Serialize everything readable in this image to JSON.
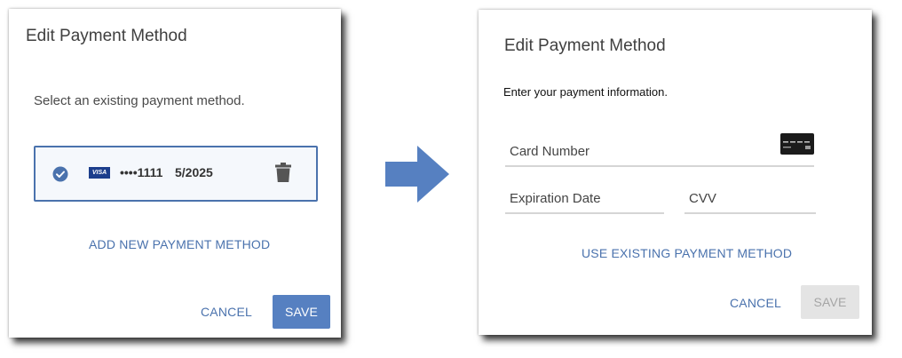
{
  "left_dialog": {
    "title": "Edit Payment Method",
    "prompt": "Select an existing payment method.",
    "saved_card": {
      "brand": "VISA",
      "masked_number": "••••1111",
      "expiration": "5/2025",
      "selected": true
    },
    "add_new_label": "ADD NEW PAYMENT METHOD",
    "cancel_label": "CANCEL",
    "save_label": "SAVE"
  },
  "right_dialog": {
    "title": "Edit Payment Method",
    "prompt": "Enter your payment information.",
    "card_number_label": "Card Number",
    "expiration_label": "Expiration Date",
    "cvv_label": "CVV",
    "use_existing_label": "USE EXISTING PAYMENT METHOD",
    "cancel_label": "CANCEL",
    "save_label": "SAVE",
    "save_enabled": false
  },
  "icons": {
    "check": "check-circle-icon",
    "card_brand": "visa-logo-icon",
    "delete": "trash-icon",
    "credit_card": "credit-card-icon",
    "transition": "arrow-right-icon"
  },
  "colors": {
    "accent": "#4a72ad",
    "primary_button": "#5680c1",
    "disabled_button_bg": "#e4e4e4",
    "disabled_button_text": "#a5a5a5",
    "selected_card_border": "#4a72ad",
    "transition_arrow": "#5680c1"
  }
}
